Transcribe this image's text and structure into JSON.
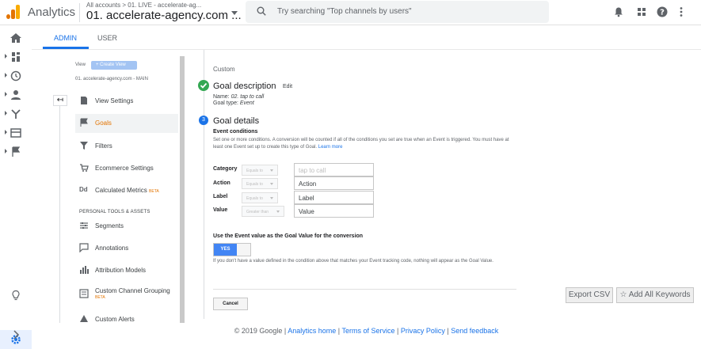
{
  "app": {
    "name": "Analytics"
  },
  "account": {
    "breadcrumb": "All accounts > 01. LIVE - accelerate-ag...",
    "title": "01. accelerate-agency.com ..."
  },
  "search": {
    "placeholder": "Try searching \"Top channels by users\""
  },
  "tabs": {
    "admin": "ADMIN",
    "user": "USER"
  },
  "view": {
    "label": "View",
    "create_view": "+ Create View",
    "name": "01. accelerate-agency.com - MAIN"
  },
  "menu": {
    "items": [
      {
        "label": "View Settings",
        "icon": "document-icon"
      },
      {
        "label": "Goals",
        "icon": "flag-icon"
      },
      {
        "label": "Filters",
        "icon": "filter-icon"
      },
      {
        "label": "Ecommerce Settings",
        "icon": "cart-icon"
      },
      {
        "label": "Calculated Metrics",
        "beta": "BETA",
        "icon": "dd-icon"
      }
    ],
    "section_head": "PERSONAL TOOLS & ASSETS",
    "tools": [
      {
        "label": "Segments",
        "icon": "segments-icon"
      },
      {
        "label": "Annotations",
        "icon": "annotation-icon"
      },
      {
        "label": "Attribution Models",
        "icon": "bar-chart-icon"
      },
      {
        "label": "Custom Channel Grouping",
        "sub": "BETA",
        "icon": "channel-icon"
      },
      {
        "label": "Custom Alerts",
        "icon": "alert-icon"
      }
    ]
  },
  "goal": {
    "custom_label": "Custom",
    "desc_title": "Goal description",
    "edit": "Edit",
    "name_prefix": "Name:",
    "name_value": "02. tap to call",
    "type_prefix": "Goal type:",
    "type_value": "Event",
    "step_number": "3",
    "details_title": "Goal details",
    "event_conditions": "Event conditions",
    "event_desc": "Set one or more conditions. A conversion will be counted if all of the conditions you set are true when an Event is triggered. You must have at least one Event set up to create this type of Goal.",
    "learn_more": "Learn more",
    "conditions": [
      {
        "label": "Category",
        "operator": "Equals to",
        "value": "tap to call",
        "placeholder": true
      },
      {
        "label": "Action",
        "operator": "Equals to",
        "value": "Action",
        "placeholder": false
      },
      {
        "label": "Label",
        "operator": "Equals to",
        "value": "Label",
        "placeholder": false
      },
      {
        "label": "Value",
        "operator": "Greater than",
        "value": "Value",
        "placeholder": false
      }
    ],
    "event_value_head": "Use the Event value as the Goal Value for the conversion",
    "toggle_label": "YES",
    "event_value_desc": "If you don't have a value defined in the condition above that matches your Event tracking code, nothing will appear as the Goal Value.",
    "cancel": "Cancel"
  },
  "actions": {
    "export_csv": "Export CSV",
    "add_keywords": "Add All Keywords"
  },
  "footer": {
    "copyright": "© 2019 Google",
    "links": [
      "Analytics home",
      "Terms of Service",
      "Privacy Policy",
      "Send feedback"
    ]
  }
}
